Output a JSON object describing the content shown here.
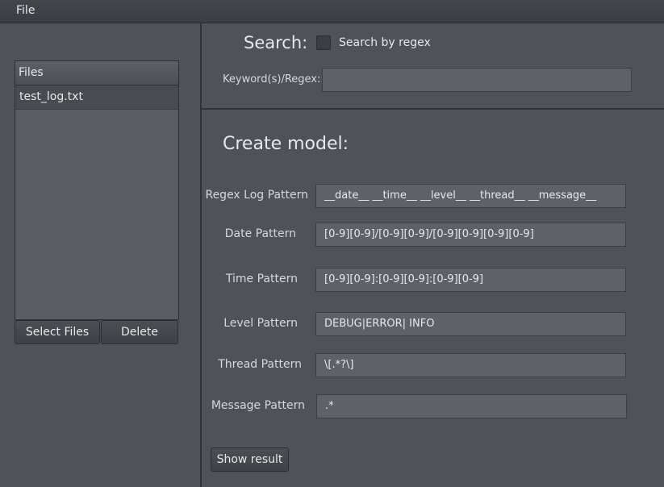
{
  "menu": {
    "file": "File"
  },
  "files": {
    "header": "Files",
    "items": [
      "test_log.txt"
    ],
    "select_button": "Select Files",
    "delete_button": "Delete"
  },
  "search": {
    "title": "Search:",
    "regex_checkbox_label": "Search by regex",
    "regex_checked": false,
    "keyword_label": "Keyword(s)/Regex:",
    "keyword_value": ""
  },
  "model": {
    "title": "Create model:",
    "fields": [
      {
        "label": "Regex Log Pattern",
        "value": "__date__ __time__ __level__ __thread__ __message__"
      },
      {
        "label": "Date Pattern",
        "value": "[0-9][0-9]/[0-9][0-9]/[0-9][0-9][0-9][0-9]"
      },
      {
        "label": "Time Pattern",
        "value": "[0-9][0-9]:[0-9][0-9]:[0-9][0-9]"
      },
      {
        "label": "Level Pattern",
        "value": "DEBUG|ERROR| INFO"
      },
      {
        "label": "Thread Pattern",
        "value": "\\[.*?\\]"
      },
      {
        "label": "Message Pattern",
        "value": ".*"
      }
    ],
    "show_result_button": "Show result"
  },
  "colors": {
    "background": "#4f5359",
    "field_background": "#5e6268",
    "text": "#e6e8ea"
  }
}
